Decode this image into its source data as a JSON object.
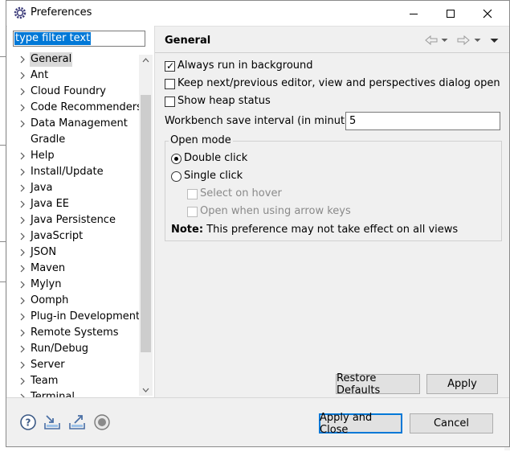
{
  "window": {
    "title": "Preferences",
    "icon": "eclipse-gear-icon",
    "controls": [
      "minimize-icon",
      "maximize-icon",
      "close-icon"
    ]
  },
  "filter": {
    "value": "type filter text"
  },
  "tree": {
    "selected": "General",
    "items": [
      {
        "label": "General",
        "expandable": true
      },
      {
        "label": "Ant",
        "expandable": true
      },
      {
        "label": "Cloud Foundry",
        "expandable": true
      },
      {
        "label": "Code Recommenders",
        "expandable": true
      },
      {
        "label": "Data Management",
        "expandable": true
      },
      {
        "label": "Gradle",
        "expandable": false
      },
      {
        "label": "Help",
        "expandable": true
      },
      {
        "label": "Install/Update",
        "expandable": true
      },
      {
        "label": "Java",
        "expandable": true
      },
      {
        "label": "Java EE",
        "expandable": true
      },
      {
        "label": "Java Persistence",
        "expandable": true
      },
      {
        "label": "JavaScript",
        "expandable": true
      },
      {
        "label": "JSON",
        "expandable": true
      },
      {
        "label": "Maven",
        "expandable": true
      },
      {
        "label": "Mylyn",
        "expandable": true
      },
      {
        "label": "Oomph",
        "expandable": true
      },
      {
        "label": "Plug-in Development",
        "expandable": true
      },
      {
        "label": "Remote Systems",
        "expandable": true
      },
      {
        "label": "Run/Debug",
        "expandable": true
      },
      {
        "label": "Server",
        "expandable": true
      },
      {
        "label": "Team",
        "expandable": true
      },
      {
        "label": "Terminal",
        "expandable": true
      }
    ]
  },
  "page": {
    "title": "General",
    "nav_icons": [
      "back-arrow-icon",
      "dropdown-icon",
      "forward-arrow-icon",
      "dropdown-icon",
      "view-menu-icon"
    ]
  },
  "options": {
    "always_run_background": {
      "label": "Always run in background",
      "checked": true
    },
    "keep_next_prev": {
      "label": "Keep next/previous editor, view and perspectives dialog open",
      "checked": false
    },
    "show_heap": {
      "label": "Show heap status",
      "checked": false
    }
  },
  "workbench_interval": {
    "label": "Workbench save interval (in minutes):",
    "value": "5"
  },
  "open_mode": {
    "legend": "Open mode",
    "double_click": {
      "label": "Double click",
      "selected": true
    },
    "single_click": {
      "label": "Single click",
      "selected": false
    },
    "select_on_hover": {
      "label": "Select on hover",
      "checked": false,
      "enabled": false
    },
    "open_arrow_keys": {
      "label": "Open when using arrow keys",
      "checked": false,
      "enabled": false
    },
    "note_bold": "Note:",
    "note_text": "This preference may not take effect on all views"
  },
  "buttons": {
    "restore_defaults": "Restore Defaults",
    "apply": "Apply",
    "apply_and_close": "Apply and Close",
    "cancel": "Cancel"
  },
  "bottom_icons": [
    "help-icon",
    "import-icon",
    "export-icon",
    "record-icon"
  ]
}
